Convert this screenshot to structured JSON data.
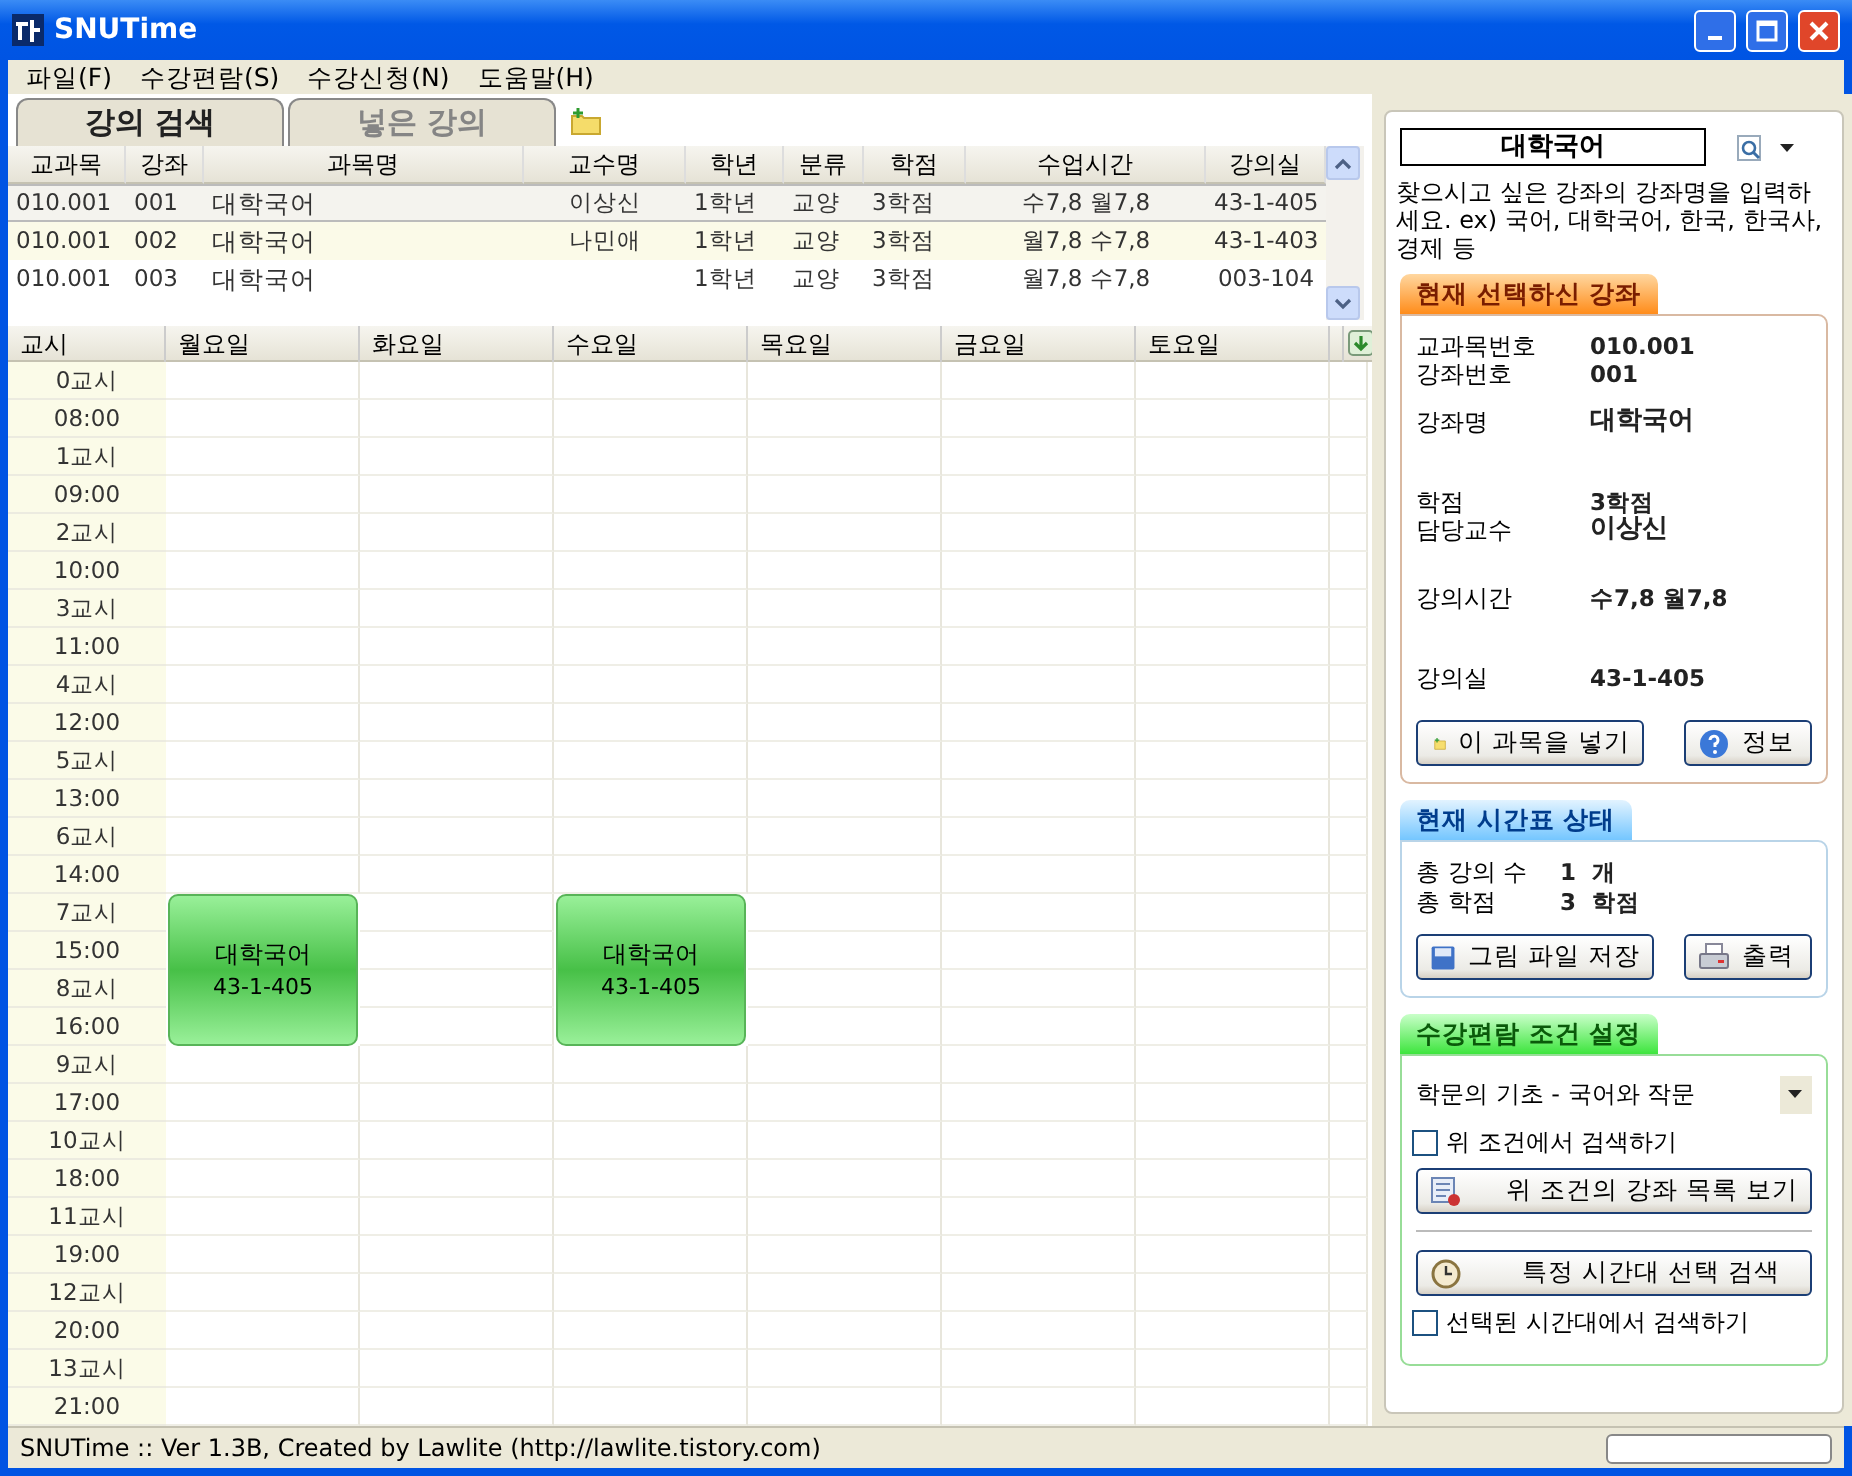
{
  "window": {
    "title": "SNUTime"
  },
  "menu": [
    "파일(F)",
    "수강편람(S)",
    "수강신청(N)",
    "도움말(H)"
  ],
  "tabs": [
    {
      "label": "강의 검색",
      "selected": true
    },
    {
      "label": "넣은 강의",
      "selected": false
    }
  ],
  "course_table": {
    "columns": [
      "교과목",
      "강좌",
      "과목명",
      "교수명",
      "학년",
      "분류",
      "학점",
      "수업시간",
      "강의실"
    ],
    "rows": [
      {
        "selected": true,
        "cells": [
          "010.001",
          "001",
          "대학국어",
          "이상신",
          "1학년",
          "교양",
          "3학점",
          "수7,8 월7,8",
          "43-1-405"
        ]
      },
      {
        "selected": false,
        "cells": [
          "010.001",
          "002",
          "대학국어",
          "나민애",
          "1학년",
          "교양",
          "3학점",
          "월7,8 수7,8",
          "43-1-403"
        ]
      },
      {
        "selected": false,
        "cells": [
          "010.001",
          "003",
          "대학국어",
          "",
          "1학년",
          "교양",
          "3학점",
          "월7,8 수7,8",
          "003-104"
        ]
      }
    ]
  },
  "timetable": {
    "corner": "교시",
    "times": [
      "0교시",
      "08:00",
      "1교시",
      "09:00",
      "2교시",
      "10:00",
      "3교시",
      "11:00",
      "4교시",
      "12:00",
      "5교시",
      "13:00",
      "6교시",
      "14:00",
      "7교시",
      "15:00",
      "8교시",
      "16:00",
      "9교시",
      "17:00",
      "10교시",
      "18:00",
      "11교시",
      "19:00",
      "12교시",
      "20:00",
      "13교시",
      "21:00"
    ],
    "days": [
      {
        "label": "월요일",
        "classes": [
          {
            "title": "대학국어",
            "room": "43-1-405"
          }
        ],
        "booked": [
          false,
          false,
          false,
          false,
          false,
          false,
          false,
          false,
          false,
          false,
          false,
          false,
          false,
          false,
          true,
          true,
          true,
          true,
          false,
          false,
          false,
          false,
          false,
          false,
          false,
          false,
          false,
          false
        ]
      },
      {
        "label": "화요일",
        "booked": [
          false,
          false,
          false,
          false,
          false,
          false,
          false,
          false,
          false,
          false,
          false,
          false,
          false,
          false,
          false,
          false,
          false,
          false,
          false,
          false,
          false,
          false,
          false,
          false,
          false,
          false,
          false,
          false
        ]
      },
      {
        "label": "수요일",
        "classes": [
          {
            "title": "대학국어",
            "room": "43-1-405"
          }
        ],
        "booked": [
          false,
          false,
          false,
          false,
          false,
          false,
          false,
          false,
          false,
          false,
          false,
          false,
          false,
          false,
          true,
          true,
          true,
          true,
          false,
          false,
          false,
          false,
          false,
          false,
          false,
          false,
          false,
          false
        ]
      },
      {
        "label": "목요일",
        "booked": [
          false,
          false,
          false,
          false,
          false,
          false,
          false,
          false,
          false,
          false,
          false,
          false,
          false,
          false,
          false,
          false,
          false,
          false,
          false,
          false,
          false,
          false,
          false,
          false,
          false,
          false,
          false,
          false
        ]
      },
      {
        "label": "금요일",
        "booked": [
          false,
          false,
          false,
          false,
          false,
          false,
          false,
          false,
          false,
          false,
          false,
          false,
          false,
          false,
          false,
          false,
          false,
          false,
          false,
          false,
          false,
          false,
          false,
          false,
          false,
          false,
          false,
          false
        ]
      },
      {
        "label": "토요일",
        "booked": [
          false,
          false,
          false,
          false,
          false,
          false,
          false,
          false,
          false,
          false,
          false,
          false,
          false,
          false,
          false,
          false,
          false,
          false,
          false,
          false,
          false,
          false,
          false,
          false,
          false,
          false,
          false,
          false
        ]
      }
    ]
  },
  "search": {
    "value": "대학국어",
    "hint": "찾으시고 싶은 강좌의 강좌명을 입력하세요. ex) 국어, 대학국어, 한국, 한국사, 경제 등"
  },
  "selected_course": {
    "title": "현재 선택하신 강좌",
    "groups": [
      [
        {
          "label": "교과목번호",
          "value": "010.001",
          "emphasis": false
        },
        {
          "label": "강좌번호",
          "value": "001",
          "emphasis": false
        }
      ],
      [
        {
          "label": "강좌명",
          "value": "대학국어",
          "emphasis": true
        }
      ],
      [
        {
          "label": "학점",
          "value": "3학점",
          "emphasis": false
        },
        {
          "label": "담당교수",
          "value": "이상신",
          "emphasis": true
        }
      ],
      [
        {
          "label": "강의시간",
          "value": "수7,8 월7,8",
          "emphasis": false
        }
      ],
      [
        {
          "label": "강의실",
          "value": "43-1-405",
          "emphasis": false
        }
      ]
    ],
    "buttons": [
      "이 과목을 넣기",
      "정보"
    ]
  },
  "schedule_status": {
    "title": "현재 시간표 상태",
    "fields": [
      {
        "label": "총 강의 수",
        "value": "1",
        "unit": "개"
      },
      {
        "label": "총 학점",
        "value": "3",
        "unit": "학점"
      }
    ],
    "buttons": [
      "그림 파일 저장",
      "출력"
    ]
  },
  "catalog_filter": {
    "title": "수강편람 조건 설정",
    "category": "학문의 기초 - 국어와 작문",
    "filter_checkbox": {
      "label": "위 조건에서 검색하기",
      "checked": false
    },
    "list_button": "위 조건의 강좌 목록 보기",
    "time_button": "특정 시간대 선택 검색",
    "time_checkbox": {
      "label": "선택된 시간대에서 검색하기",
      "checked": false
    }
  },
  "status_bar": {
    "text": "SNUTime :: Ver 1.3B, Created by Lawlite (http://lawlite.tistory.com)"
  }
}
